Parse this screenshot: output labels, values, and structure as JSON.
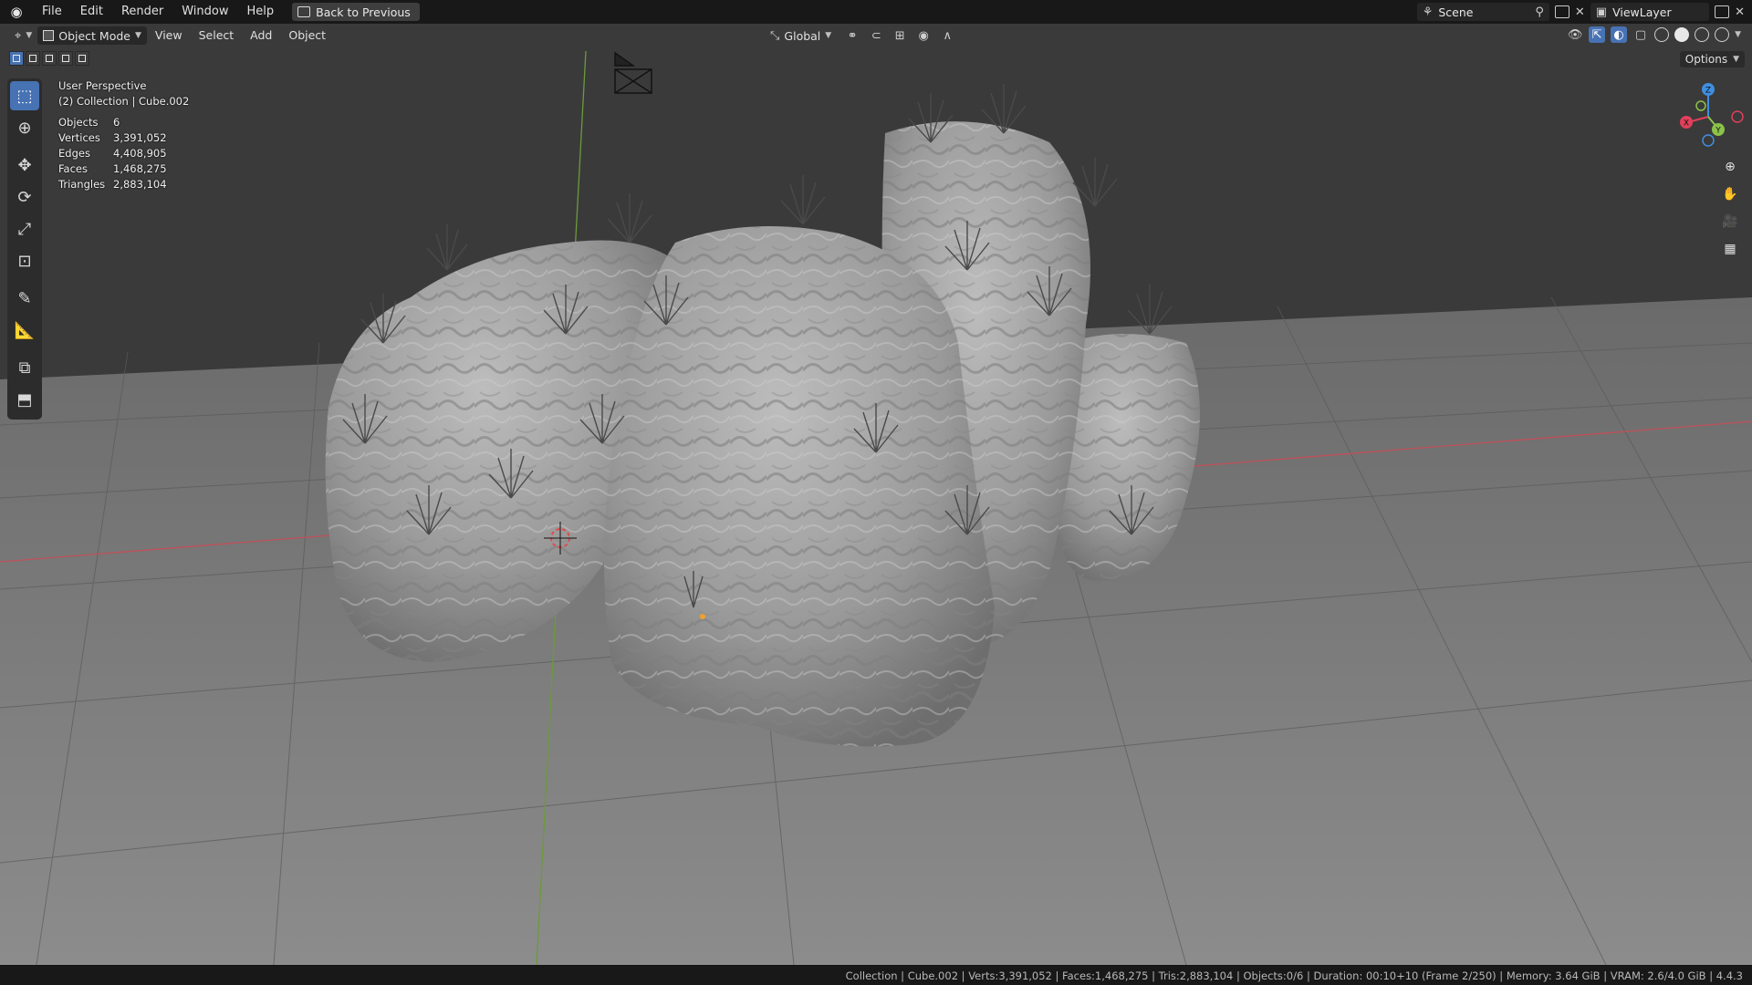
{
  "menubar": {
    "items": [
      "File",
      "Edit",
      "Render",
      "Window",
      "Help"
    ],
    "back_label": "Back to Previous",
    "scene": "Scene",
    "viewlayer": "ViewLayer"
  },
  "viewport_header": {
    "mode": "Object Mode",
    "menus": [
      "View",
      "Select",
      "Add",
      "Object"
    ],
    "orientation": "Global",
    "options_label": "Options"
  },
  "overlay": {
    "perspective": "User Perspective",
    "collection": "(2) Collection | Cube.002",
    "stats": [
      {
        "label": "Objects",
        "value": "6"
      },
      {
        "label": "Vertices",
        "value": "3,391,052"
      },
      {
        "label": "Edges",
        "value": "4,408,905"
      },
      {
        "label": "Faces",
        "value": "1,468,275"
      },
      {
        "label": "Triangles",
        "value": "2,883,104"
      }
    ]
  },
  "gizmo": {
    "x": "X",
    "y": "Y",
    "z": "Z",
    "x_color": "#e0405a",
    "y_color": "#8bc34a",
    "z_color": "#3f8fe0"
  },
  "status": {
    "text": "Collection | Cube.002 | Verts:3,391,052 | Faces:1,468,275 | Tris:2,883,104 | Objects:0/6 | Duration: 00:10+10 (Frame 2/250) | Memory: 3.64 GiB | VRAM: 2.6/4.0 GiB | 4.4.3"
  },
  "colors": {
    "accent": "#4772b3",
    "floor": "#7a7a7a",
    "sky": "#3a3a3a"
  }
}
